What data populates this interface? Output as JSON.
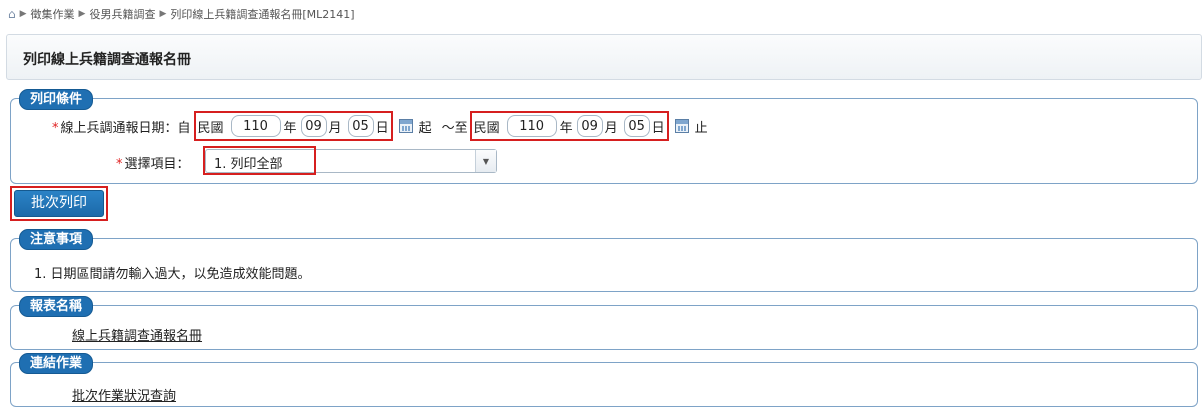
{
  "breadcrumb": {
    "items": [
      "徵集作業",
      "役男兵籍調查",
      "列印線上兵籍調查通報名冊[ML2141]"
    ]
  },
  "page": {
    "title": "列印線上兵籍調查通報名冊"
  },
  "print_conditions": {
    "legend": "列印條件",
    "date_label": "線上兵調通報日期：自",
    "from": {
      "era": "民國",
      "year": "110",
      "year_unit": "年",
      "month": "09",
      "month_unit": "月",
      "day": "05",
      "day_unit": "日"
    },
    "from_suffix": "起",
    "to_label": "～至",
    "to": {
      "era": "民國",
      "year": "110",
      "year_unit": "年",
      "month": "09",
      "month_unit": "月",
      "day": "05",
      "day_unit": "日"
    },
    "to_suffix": "止",
    "item_label": "選擇項目：",
    "item_selected": "1. 列印全部",
    "required_mark": "*"
  },
  "actions": {
    "batch_print": "批次列印"
  },
  "notes": {
    "legend": "注意事項",
    "text": "1. 日期區間請勿輸入過大，以免造成效能問題。"
  },
  "report": {
    "legend": "報表名稱",
    "link": "線上兵籍調查通報名冊"
  },
  "linked": {
    "legend": "連結作業",
    "link": "批次作業狀況查詢"
  },
  "colors": {
    "accent": "#1f6fb2",
    "highlight": "#d61f1f",
    "required": "#e02020",
    "border": "#7ea3c7"
  }
}
